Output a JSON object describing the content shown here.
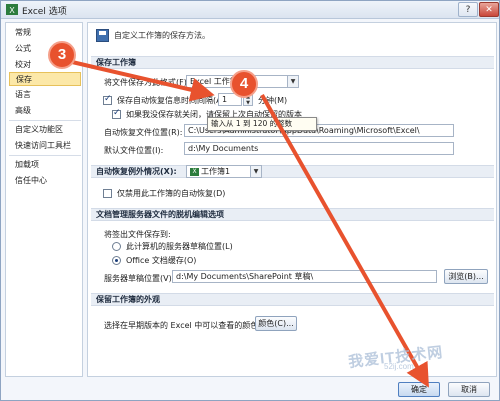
{
  "window": {
    "title": "Excel 选项",
    "help_label": "?",
    "close_label": "✕"
  },
  "sidebar": {
    "items": [
      {
        "label": "常规"
      },
      {
        "label": "公式"
      },
      {
        "label": "校对"
      },
      {
        "label": "保存"
      },
      {
        "label": "语言"
      },
      {
        "label": "高级"
      },
      {
        "label": "自定义功能区"
      },
      {
        "label": "快速访问工具栏"
      },
      {
        "label": "加载项"
      },
      {
        "label": "信任中心"
      }
    ],
    "selected": "保存"
  },
  "main": {
    "header_text": "自定义工作簿的保存方法。",
    "save_section": {
      "title": "保存工作簿",
      "format_label": "将文件保存为此格式(F):",
      "format_value": "Excel 工作簿",
      "autorecover_label": "保存自动恢复信息时间间隔(A)",
      "autorecover_value": "1",
      "minutes_label": "分钟(M)",
      "keep_last_label": "如果我没保存就关闭，请保留上次自动保留的版本",
      "autorecover_location_label": "自动恢复文件位置(R):",
      "autorecover_location_value": "C:\\Users\\Administrator\\AppData\\Roaming\\Microsoft\\Excel\\",
      "default_location_label": "默认文件位置(I):",
      "default_location_value": "d:\\My Documents"
    },
    "tooltip_text": "输入从 1 到 120 的整数",
    "exceptions_section": {
      "title_prefix": "自动恢复例外情况(X):",
      "workbook_value": "工作簿1",
      "workbook_badge": "X",
      "disable_label": "仅禁用此工作簿的自动恢复(D)"
    },
    "offline_section": {
      "title": "文档管理服务器文件的脱机编辑选项",
      "save_to_label": "将签出文件保存到:",
      "option_server_drafts": "此计算机的服务器草稿位置(L)",
      "option_office_cache": "Office 文档缓存(O)",
      "server_drafts_label": "服务器草稿位置(V):",
      "server_drafts_value": "d:\\My Documents\\SharePoint 草稿\\",
      "browse_label": "浏览(B)..."
    },
    "appearance_section": {
      "title": "保留工作簿的外观",
      "colors_desc": "选择在早期版本的 Excel 中可以查看的颜色:",
      "colors_button": "颜色(C)..."
    }
  },
  "footer": {
    "ok_label": "确定",
    "cancel_label": "取消"
  },
  "annotations": {
    "step3": "3",
    "step4": "4",
    "arrow_color": "#e8522e"
  },
  "watermark": {
    "text": "我爱IT技术网",
    "url": "52ij.com"
  }
}
